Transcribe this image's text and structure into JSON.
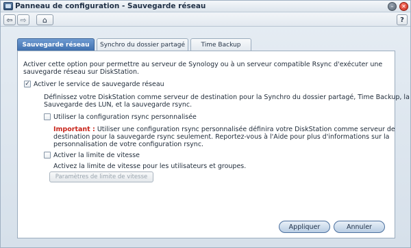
{
  "window": {
    "title": "Panneau de configuration - Sauvegarde réseau",
    "minimize_glyph": "–",
    "close_glyph": "✕"
  },
  "toolbar": {
    "back_glyph": "⇦",
    "forward_glyph": "⇨",
    "home_glyph": "⌂",
    "help_glyph": "?"
  },
  "tabs": [
    {
      "label": "Sauvegarde réseau",
      "active": true
    },
    {
      "label": "Synchro du dossier partagé",
      "active": false
    },
    {
      "label": "Time Backup",
      "active": false
    }
  ],
  "intro": {
    "line1": "Activer cette option pour permettre au serveur de Synology ou à un serveur compatible Rsync d'exécuter une",
    "line2": "sauvegarde réseau sur DiskStation."
  },
  "options": {
    "network_backup": {
      "label": "Activer le service de sauvegarde réseau",
      "checked": true,
      "check_glyph": "✓",
      "desc_line1": "Définissez votre DiskStation comme serveur de destination pour la Synchro du dossier partagé, Time Backup, la",
      "desc_line2": "Sauvegarde des LUN, et la sauvegarde rsync."
    },
    "custom_rsync": {
      "label": "Utiliser la configuration rsync personnalisée",
      "checked": false,
      "important_label": "Important :",
      "note_line1": "Utiliser une configuration rsync personnalisée définira votre DiskStation comme serveur de",
      "note_line2": "destination pour la sauvegarde rsync seulement. Reportez-vous à l'Aide pour plus d'informations sur la",
      "note_line3": "personnalisation de votre configuration rsync."
    },
    "speed_limit": {
      "label": "Activer la limite de vitesse",
      "checked": false,
      "desc": "Activez la limite de vitesse pour les utilisateurs et groupes.",
      "settings_button": "Paramètres de limite de vitesse"
    }
  },
  "actions": {
    "apply": "Appliquer",
    "cancel": "Annuler"
  },
  "colors": {
    "active_tab": "#4a7bbd",
    "important": "#c8261c"
  }
}
